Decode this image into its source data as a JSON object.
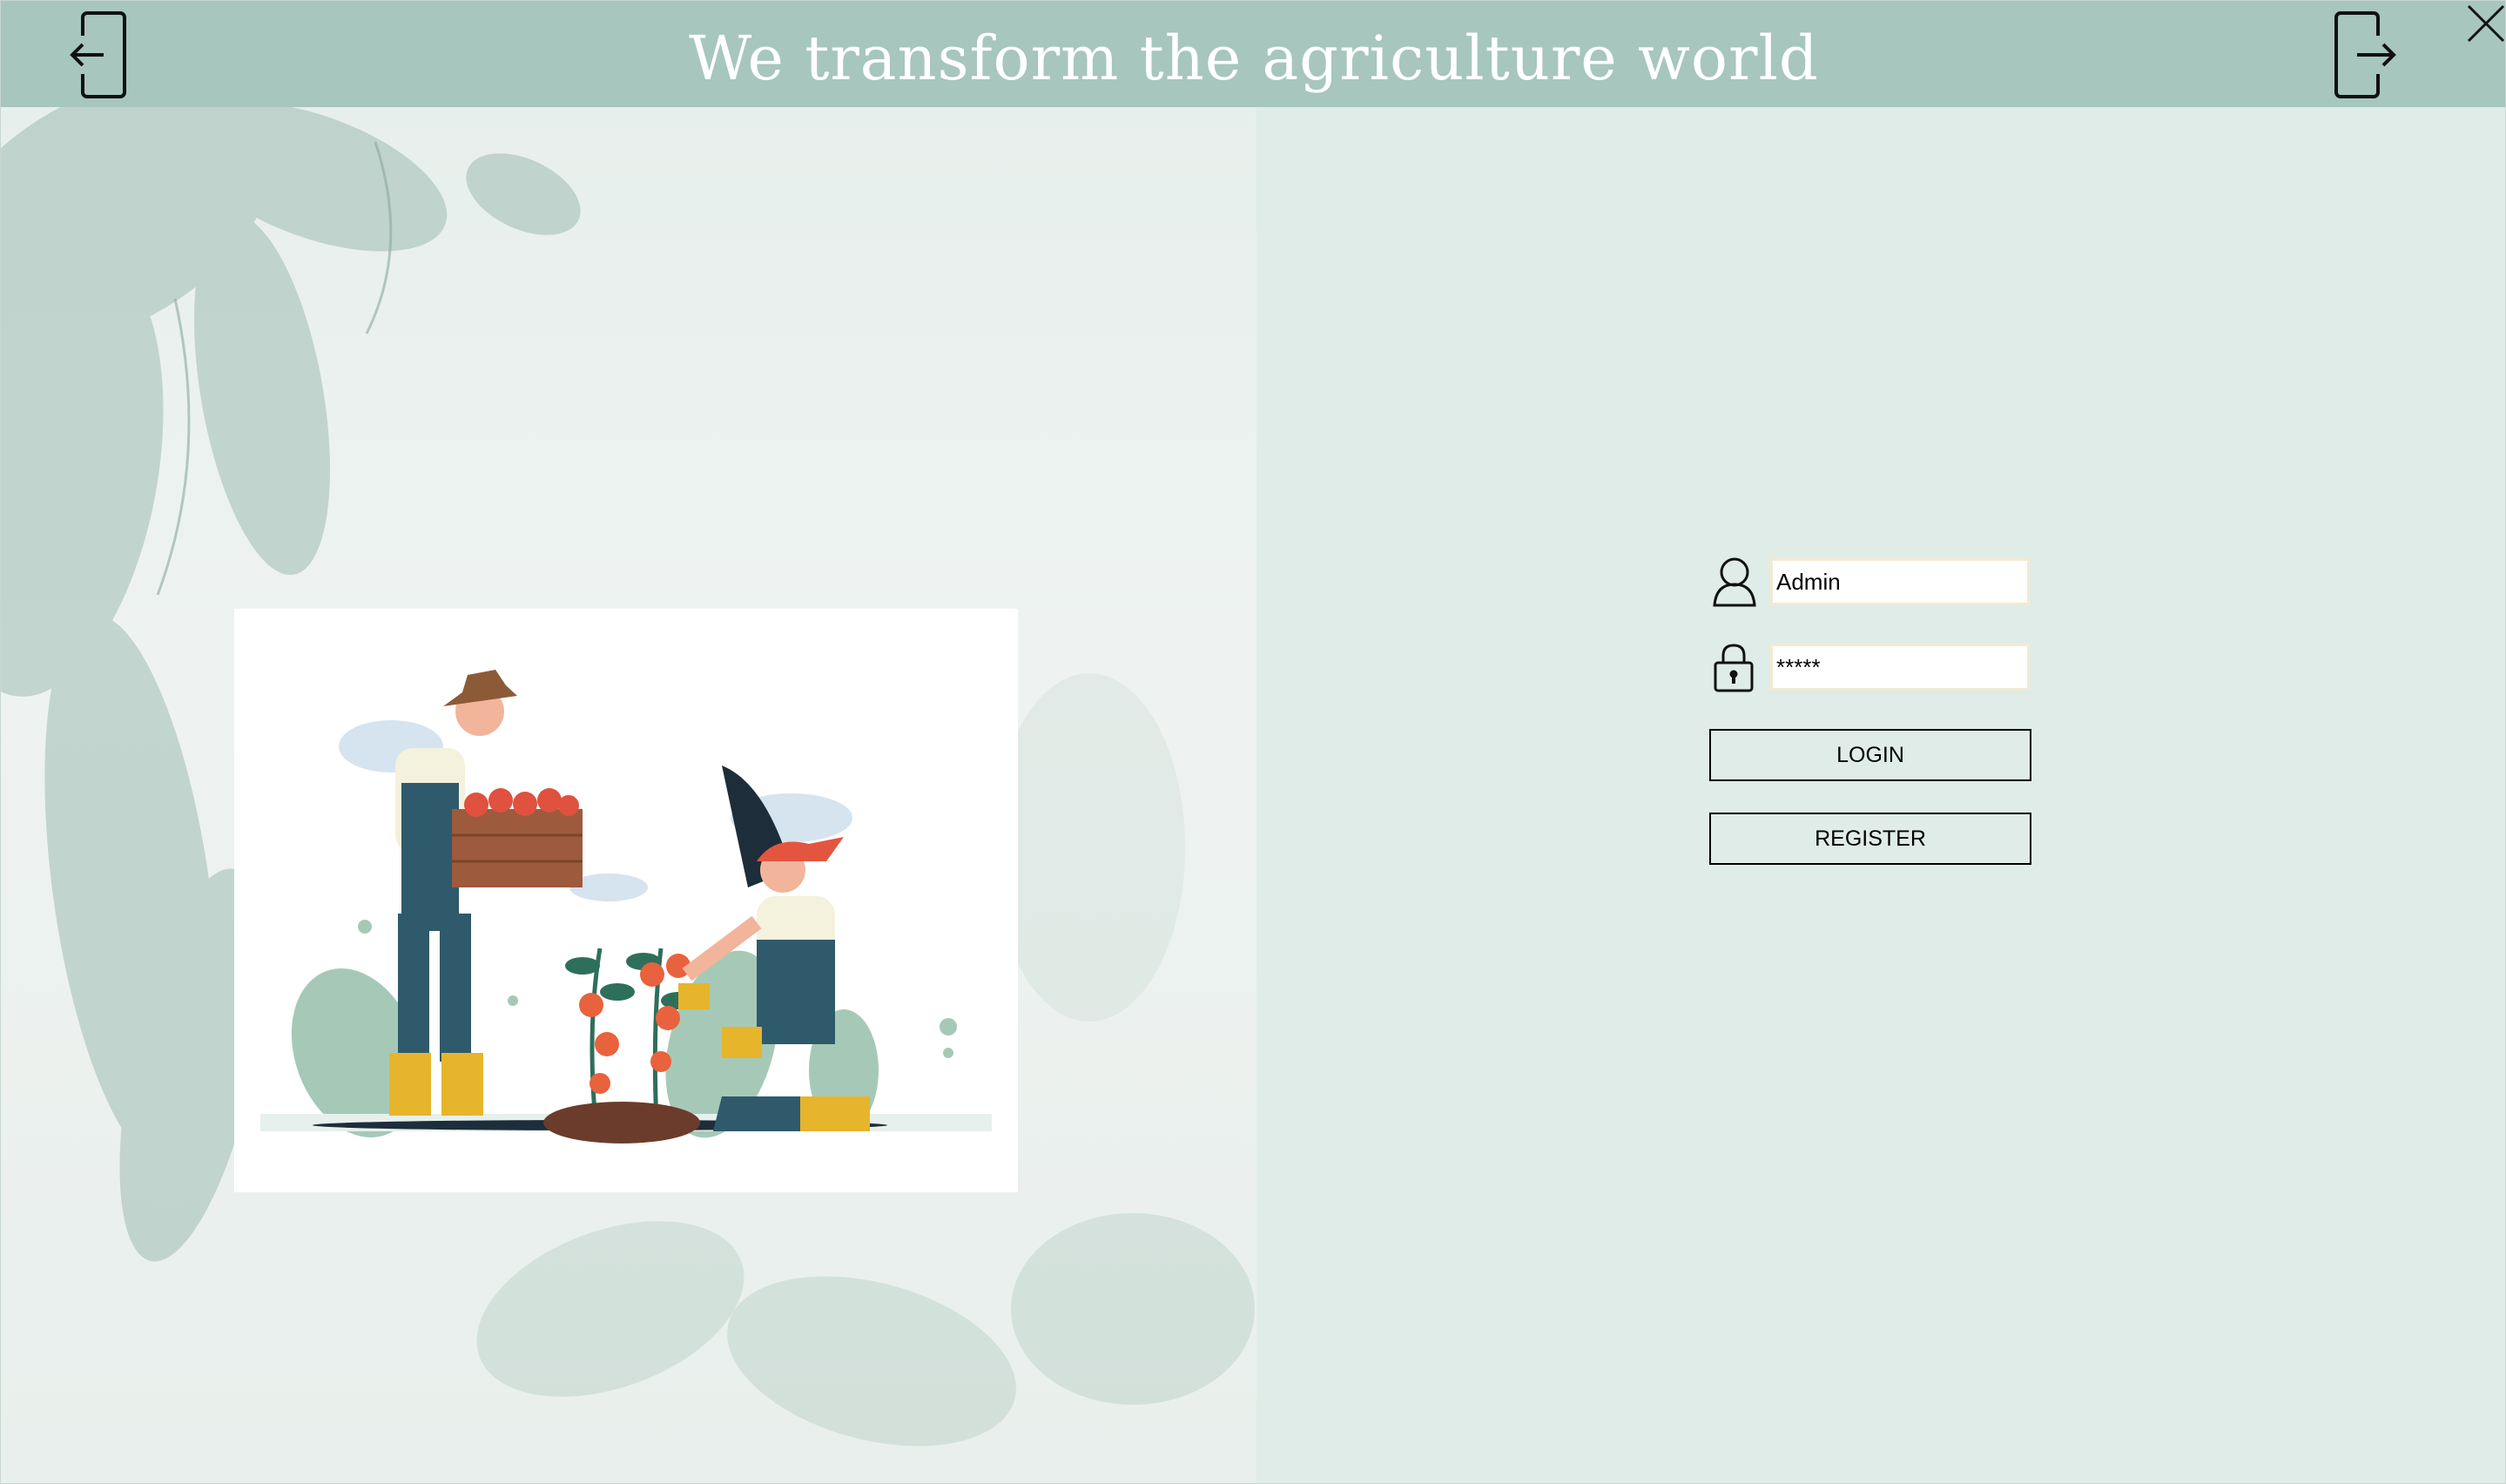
{
  "header": {
    "title": "We transform the agriculture world",
    "back_icon": "back-arrow-icon",
    "logout_icon": "logout-icon",
    "close_icon": "close-icon"
  },
  "login": {
    "username_value": "Admin",
    "password_value": "*****",
    "username_icon": "user-icon",
    "password_icon": "lock-icon",
    "login_label": "LOGIN",
    "register_label": "REGISTER"
  },
  "colors": {
    "header_bg": "#a7c6bd",
    "panel_bg": "#dfece8",
    "input_border": "#f3ead2"
  }
}
